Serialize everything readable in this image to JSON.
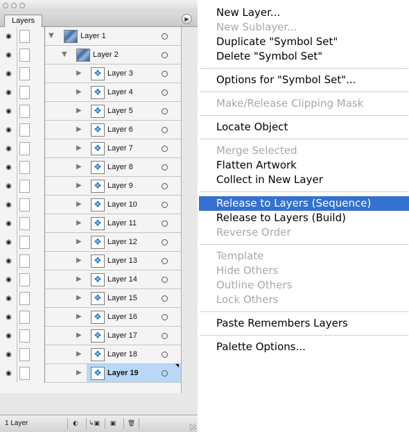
{
  "palette": {
    "tab_label": "Layers",
    "status_text": "1 Layer",
    "layers": [
      {
        "name": "Layer 1",
        "indent": 0,
        "expanded": true,
        "thumb": "blue-pattern",
        "selected": false
      },
      {
        "name": "Layer 2",
        "indent": 1,
        "expanded": true,
        "thumb": "blue-pattern",
        "selected": false
      },
      {
        "name": "Layer 3",
        "indent": 2,
        "expanded": false,
        "thumb": "butterfly",
        "selected": false
      },
      {
        "name": "Layer 4",
        "indent": 2,
        "expanded": false,
        "thumb": "butterfly",
        "selected": false
      },
      {
        "name": "Layer 5",
        "indent": 2,
        "expanded": false,
        "thumb": "butterfly",
        "selected": false
      },
      {
        "name": "Layer 6",
        "indent": 2,
        "expanded": false,
        "thumb": "butterfly",
        "selected": false
      },
      {
        "name": "Layer 7",
        "indent": 2,
        "expanded": false,
        "thumb": "butterfly",
        "selected": false
      },
      {
        "name": "Layer 8",
        "indent": 2,
        "expanded": false,
        "thumb": "butterfly",
        "selected": false
      },
      {
        "name": "Layer 9",
        "indent": 2,
        "expanded": false,
        "thumb": "butterfly",
        "selected": false
      },
      {
        "name": "Layer 10",
        "indent": 2,
        "expanded": false,
        "thumb": "butterfly",
        "selected": false
      },
      {
        "name": "Layer 11",
        "indent": 2,
        "expanded": false,
        "thumb": "butterfly",
        "selected": false
      },
      {
        "name": "Layer 12",
        "indent": 2,
        "expanded": false,
        "thumb": "butterfly",
        "selected": false
      },
      {
        "name": "Layer 13",
        "indent": 2,
        "expanded": false,
        "thumb": "butterfly",
        "selected": false
      },
      {
        "name": "Layer 14",
        "indent": 2,
        "expanded": false,
        "thumb": "butterfly",
        "selected": false
      },
      {
        "name": "Layer 15",
        "indent": 2,
        "expanded": false,
        "thumb": "butterfly",
        "selected": false
      },
      {
        "name": "Layer 16",
        "indent": 2,
        "expanded": false,
        "thumb": "butterfly",
        "selected": false
      },
      {
        "name": "Layer 17",
        "indent": 2,
        "expanded": false,
        "thumb": "butterfly",
        "selected": false
      },
      {
        "name": "Layer 18",
        "indent": 2,
        "expanded": false,
        "thumb": "butterfly",
        "selected": false
      },
      {
        "name": "Layer 19",
        "indent": 2,
        "expanded": false,
        "thumb": "butterfly",
        "selected": true
      }
    ],
    "footer_icons": [
      "make-clipping-mask-icon",
      "create-sublayer-icon",
      "new-layer-icon",
      "trash-icon"
    ],
    "colors": {
      "selection": "#b9d7f7",
      "thumbnail_blue": "#3c6ea8",
      "butterfly": "#1e78d0"
    }
  },
  "menu": {
    "highlight_color": "#3470d0",
    "groups": [
      {
        "items": [
          {
            "label": "New Layer...",
            "enabled": true,
            "highlighted": false
          },
          {
            "label": "New Sublayer...",
            "enabled": false,
            "highlighted": false
          },
          {
            "label": "Duplicate \"Symbol Set\"",
            "enabled": true,
            "highlighted": false
          },
          {
            "label": "Delete \"Symbol Set\"",
            "enabled": true,
            "highlighted": false
          }
        ]
      },
      {
        "items": [
          {
            "label": "Options for \"Symbol Set\"...",
            "enabled": true,
            "highlighted": false
          }
        ]
      },
      {
        "items": [
          {
            "label": "Make/Release Clipping Mask",
            "enabled": false,
            "highlighted": false
          }
        ]
      },
      {
        "items": [
          {
            "label": "Locate Object",
            "enabled": true,
            "highlighted": false
          }
        ]
      },
      {
        "items": [
          {
            "label": "Merge Selected",
            "enabled": false,
            "highlighted": false
          },
          {
            "label": "Flatten Artwork",
            "enabled": true,
            "highlighted": false
          },
          {
            "label": "Collect in New Layer",
            "enabled": true,
            "highlighted": false
          }
        ]
      },
      {
        "items": [
          {
            "label": "Release to Layers (Sequence)",
            "enabled": true,
            "highlighted": true
          },
          {
            "label": "Release to Layers (Build)",
            "enabled": true,
            "highlighted": false
          },
          {
            "label": "Reverse Order",
            "enabled": false,
            "highlighted": false
          }
        ]
      },
      {
        "items": [
          {
            "label": "Template",
            "enabled": false,
            "highlighted": false
          },
          {
            "label": "Hide Others",
            "enabled": false,
            "highlighted": false
          },
          {
            "label": "Outline Others",
            "enabled": false,
            "highlighted": false
          },
          {
            "label": "Lock Others",
            "enabled": false,
            "highlighted": false
          }
        ]
      },
      {
        "items": [
          {
            "label": "Paste Remembers Layers",
            "enabled": true,
            "highlighted": false
          }
        ]
      },
      {
        "items": [
          {
            "label": "Palette Options...",
            "enabled": true,
            "highlighted": false
          }
        ]
      }
    ]
  }
}
